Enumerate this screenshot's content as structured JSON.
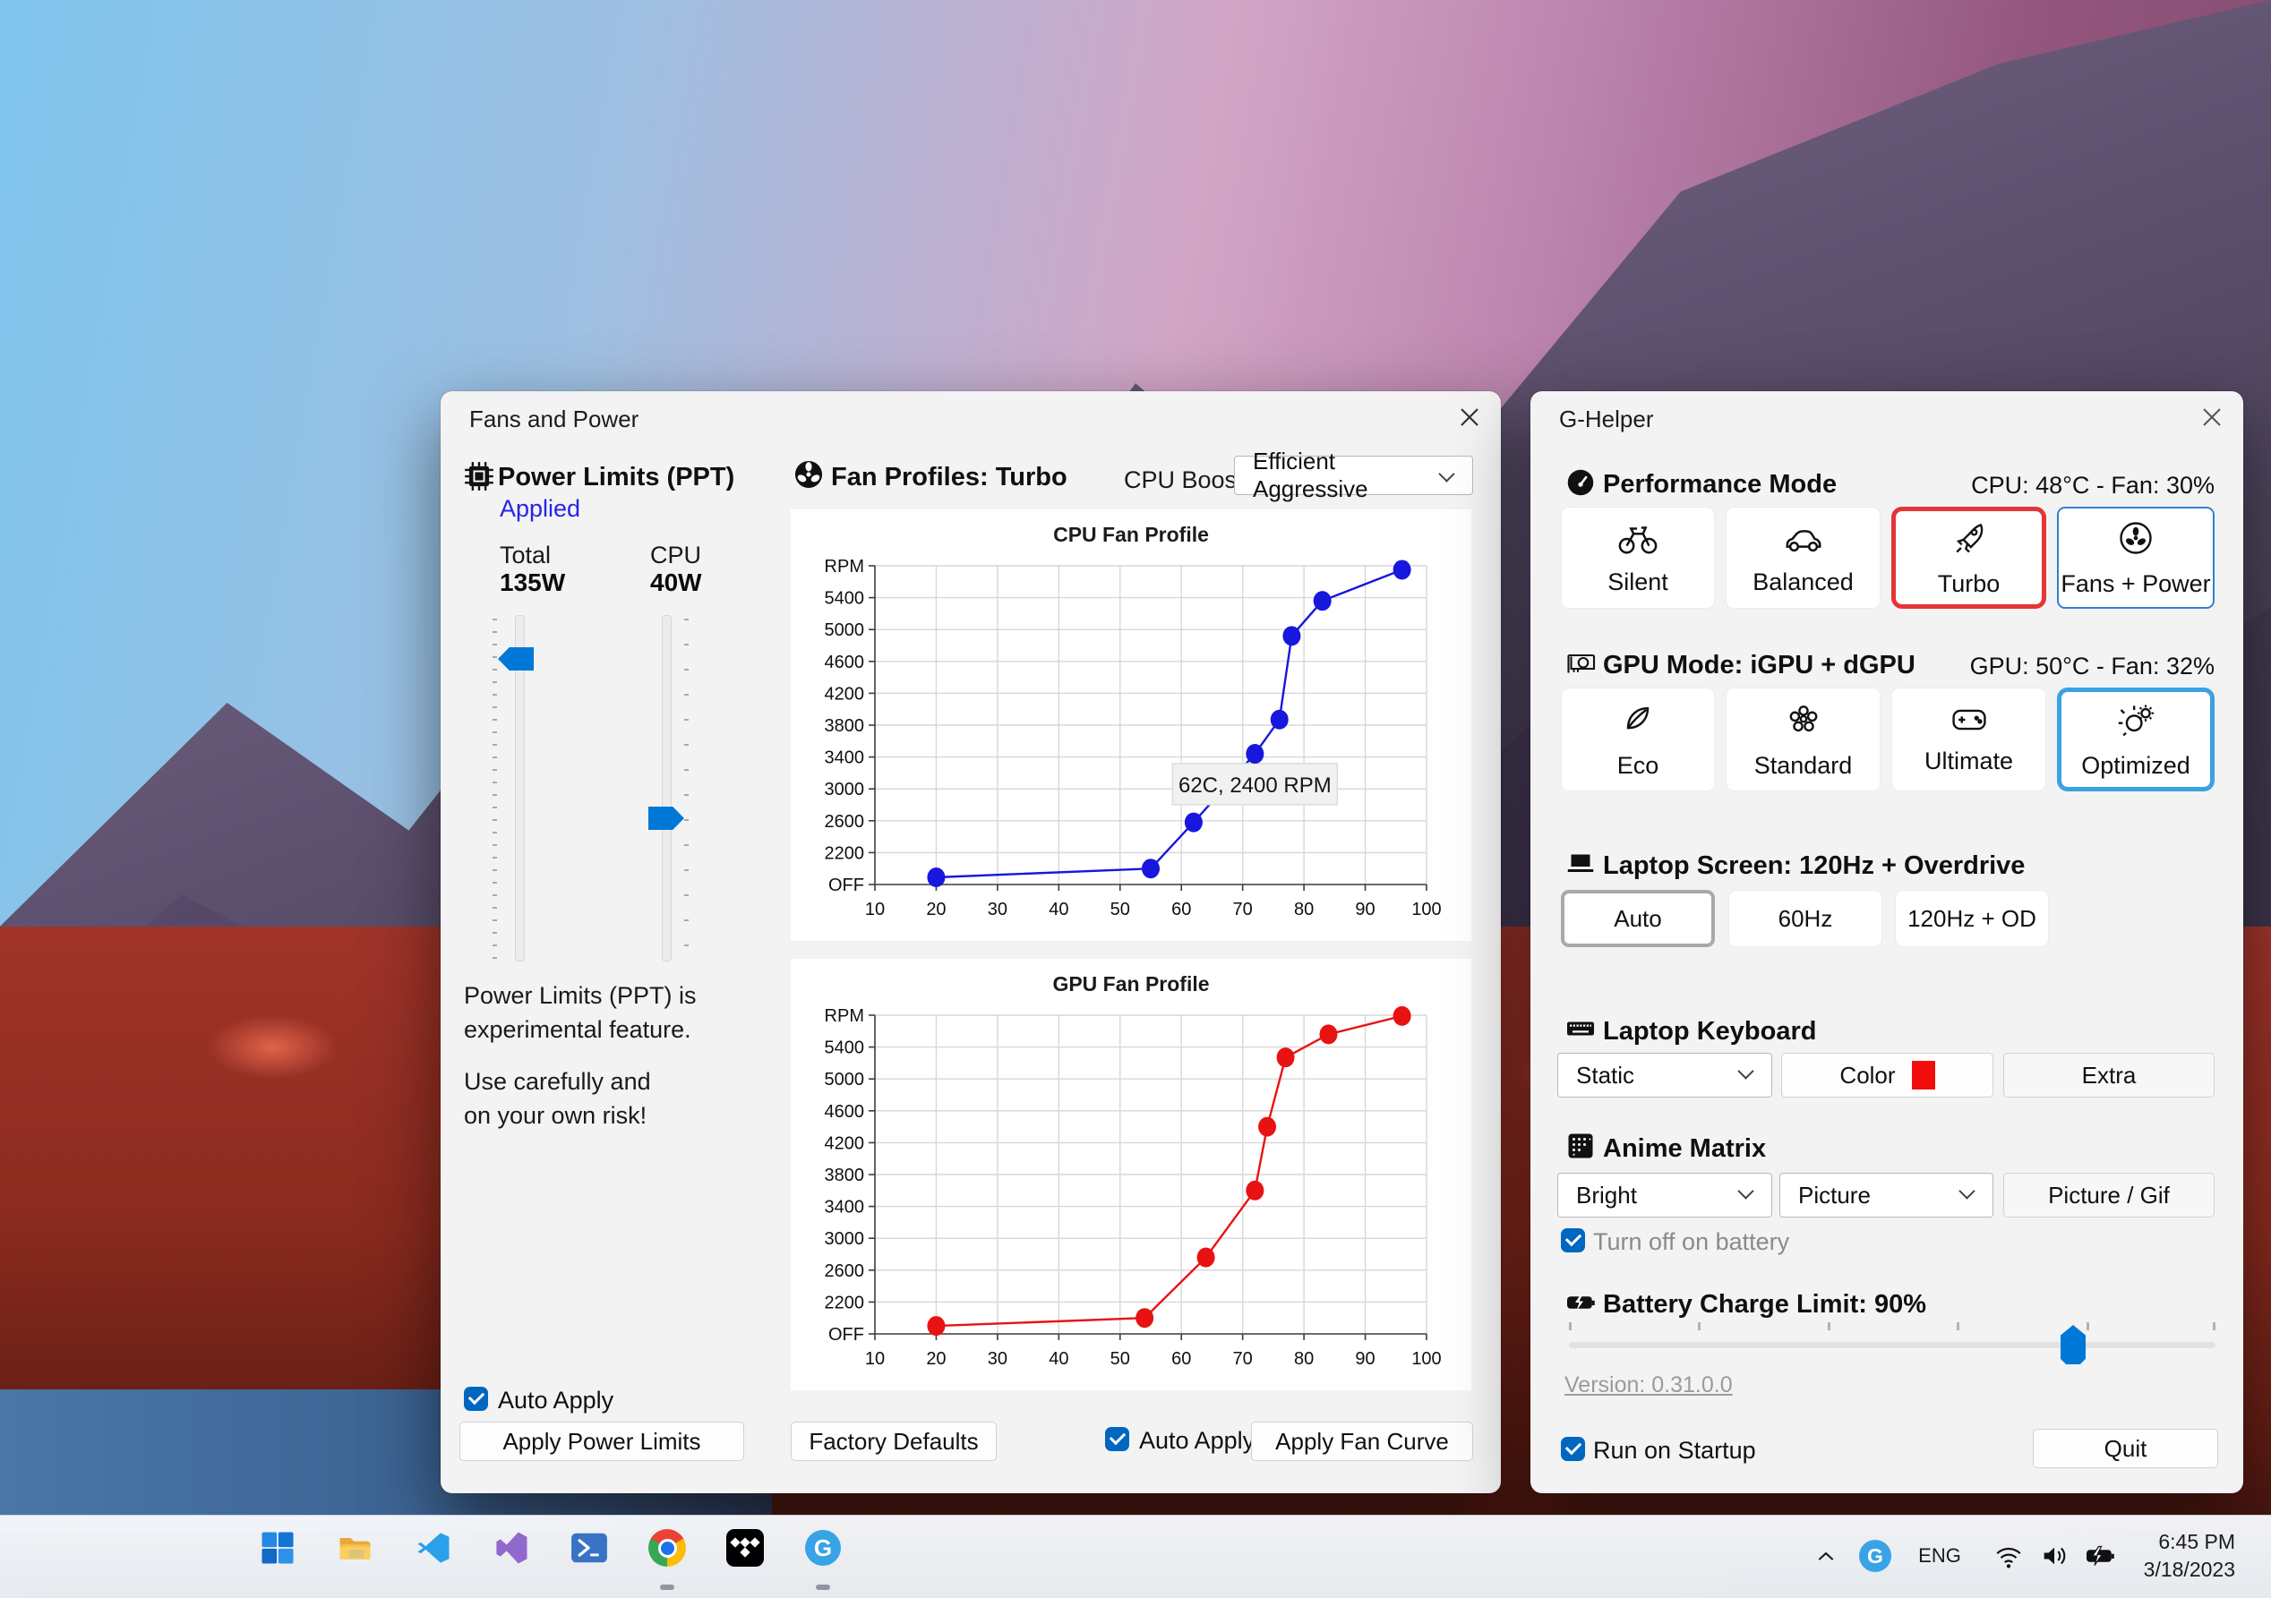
{
  "fans_window": {
    "title": "Fans and Power",
    "power_limits": {
      "heading": "Power Limits (PPT)",
      "status": "Applied",
      "columns": [
        {
          "label": "Total",
          "value": "135W"
        },
        {
          "label": "CPU",
          "value": "40W"
        }
      ],
      "notes": [
        "Power Limits (PPT) is",
        "experimental feature.",
        "Use carefully and",
        "on your own risk!"
      ],
      "auto_apply": "Auto Apply",
      "apply_button": "Apply Power Limits"
    },
    "fan_profiles": {
      "heading": "Fan Profiles: Turbo",
      "cpu_boost_label": "CPU Boost",
      "cpu_boost_value": "Efficient Aggressive",
      "factory_defaults": "Factory Defaults",
      "auto_apply": "Auto Apply",
      "apply_fan_curve": "Apply Fan Curve"
    }
  },
  "chart_data": [
    {
      "type": "line",
      "title": "CPU Fan Profile",
      "color": "#1717dd",
      "xlabel": "",
      "ylabel": "RPM",
      "xlim": [
        10,
        100
      ],
      "ylim": [
        1800,
        5800
      ],
      "grid": true,
      "x_ticks": [
        10,
        20,
        30,
        40,
        50,
        60,
        70,
        80,
        90,
        100
      ],
      "y_ticks": [
        1800,
        2200,
        2600,
        3000,
        3400,
        3800,
        4200,
        4600,
        5000,
        5400,
        5800
      ],
      "y_tick_labels": [
        "OFF",
        "2200",
        "2600",
        "3000",
        "3400",
        "3800",
        "4200",
        "4600",
        "5000",
        "5400",
        "RPM"
      ],
      "points": [
        [
          20,
          1890
        ],
        [
          55,
          2000
        ],
        [
          62,
          2580
        ],
        [
          72,
          3440
        ],
        [
          76,
          3870
        ],
        [
          78,
          4920
        ],
        [
          83,
          5360
        ],
        [
          96,
          5750
        ]
      ],
      "annotation": {
        "text": "62C, 2400 RPM",
        "x": 72,
        "y": 3060
      }
    },
    {
      "type": "line",
      "title": "GPU Fan Profile",
      "color": "#e81212",
      "xlabel": "",
      "ylabel": "RPM",
      "xlim": [
        10,
        100
      ],
      "ylim": [
        1800,
        5800
      ],
      "grid": true,
      "x_ticks": [
        10,
        20,
        30,
        40,
        50,
        60,
        70,
        80,
        90,
        100
      ],
      "y_ticks": [
        1800,
        2200,
        2600,
        3000,
        3400,
        3800,
        4200,
        4600,
        5000,
        5400,
        5800
      ],
      "y_tick_labels": [
        "OFF",
        "2200",
        "2600",
        "3000",
        "3400",
        "3800",
        "4200",
        "4600",
        "5000",
        "5400",
        "RPM"
      ],
      "points": [
        [
          20,
          1900
        ],
        [
          54,
          2000
        ],
        [
          64,
          2760
        ],
        [
          72,
          3600
        ],
        [
          74,
          4400
        ],
        [
          77,
          5270
        ],
        [
          84,
          5560
        ],
        [
          96,
          5790
        ]
      ],
      "annotation": null
    }
  ],
  "ghelper_window": {
    "title": "G-Helper",
    "performance": {
      "heading": "Performance Mode",
      "status": "CPU: 48°C -  Fan: 30%",
      "buttons": [
        {
          "label": "Silent"
        },
        {
          "label": "Balanced"
        },
        {
          "label": "Turbo"
        },
        {
          "label": "Fans + Power"
        }
      ]
    },
    "gpu": {
      "heading": "GPU Mode: iGPU + dGPU",
      "status": "GPU: 50°C -  Fan: 32%",
      "buttons": [
        {
          "label": "Eco"
        },
        {
          "label": "Standard"
        },
        {
          "label": "Ultimate"
        },
        {
          "label": "Optimized"
        }
      ]
    },
    "screen": {
      "heading": "Laptop Screen: 120Hz + Overdrive",
      "buttons": [
        {
          "label": "Auto"
        },
        {
          "label": "60Hz"
        },
        {
          "label": "120Hz + OD"
        }
      ]
    },
    "keyboard": {
      "heading": "Laptop Keyboard",
      "mode_value": "Static",
      "color_button": "Color",
      "extra_button": "Extra",
      "color_swatch": "#f20d0d"
    },
    "anime": {
      "heading": "Anime Matrix",
      "brightness_value": "Bright",
      "mode_value": "Picture",
      "picture_button": "Picture / Gif",
      "battery_checkbox": "Turn off on battery"
    },
    "battery": {
      "heading": "Battery Charge Limit: 90%",
      "percent": 90
    },
    "version_link": "Version: 0.31.0.0",
    "run_on_startup": "Run on Startup",
    "quit_button": "Quit"
  },
  "taskbar": {
    "tray": {
      "language": "ENG",
      "time": "6:45 PM",
      "date": "3/18/2023"
    },
    "ghelper_letter": "G",
    "accent_blue": "#0078d7",
    "selected_red": "#e53535",
    "selected_blue": "#3ba1e3"
  }
}
